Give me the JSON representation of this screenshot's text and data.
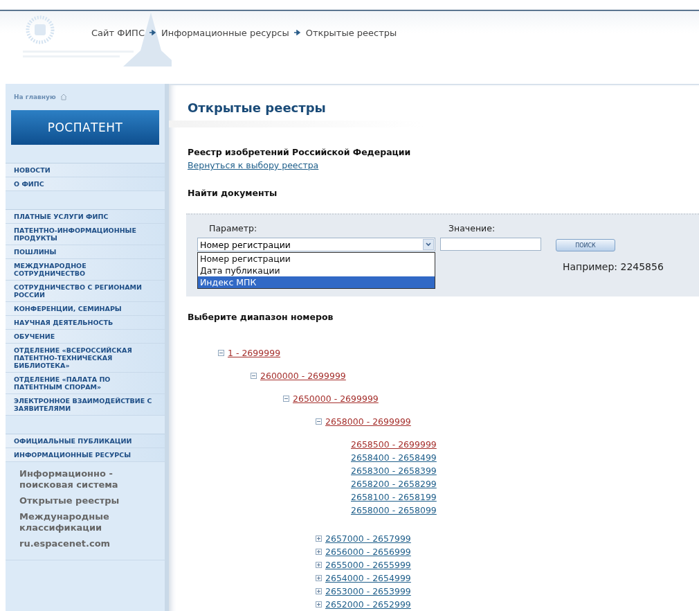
{
  "breadcrumb": [
    "Сайт ФИПС",
    "Информационные ресурсы",
    "Открытые реестры"
  ],
  "sidebar": {
    "home_link": "На главную",
    "banner": "РОСПАТЕНТ",
    "groups": [
      [
        {
          "label": "НОВОСТИ"
        },
        {
          "label": "О ФИПС"
        }
      ],
      [
        {
          "label": "ПЛАТНЫЕ УСЛУГИ ФИПС"
        },
        {
          "label": "ПАТЕНТНО-ИНФОРМАЦИОННЫЕ ПРОДУКТЫ"
        },
        {
          "label": "ПОШЛИНЫ"
        },
        {
          "label": "МЕЖДУНАРОДНОЕ СОТРУДНИЧЕСТВО"
        },
        {
          "label": "СОТРУДНИЧЕСТВО С РЕГИОНАМИ РОССИИ"
        },
        {
          "label": "КОНФЕРЕНЦИИ, СЕМИНАРЫ"
        },
        {
          "label": "НАУЧНАЯ ДЕЯТЕЛЬНОСТЬ"
        },
        {
          "label": "ОБУЧЕНИЕ"
        },
        {
          "label": "ОТДЕЛЕНИЕ «ВСЕРОССИЙСКАЯ ПАТЕНТНО-ТЕХНИЧЕСКАЯ БИБЛИОТЕКА»"
        },
        {
          "label": "ОТДЕЛЕНИЕ «ПАЛАТА ПО ПАТЕНТНЫМ СПОРАМ»"
        },
        {
          "label": "ЭЛЕКТРОННОЕ ВЗАИМОДЕЙСТВИЕ С ЗАЯВИТЕЛЯМИ"
        }
      ],
      [
        {
          "label": "ОФИЦИАЛЬНЫЕ ПУБЛИКАЦИИ"
        },
        {
          "label": "ИНФОРМАЦИОННЫЕ РЕСУРСЫ",
          "children": [
            "Информационно - поисковая система",
            "Открытые реестры",
            "Международные классификации",
            "ru.espacenet.com"
          ]
        }
      ]
    ]
  },
  "page_title": "Открытые реестры",
  "registry_title": "Реестр изобретений Российской Федерации",
  "back_link": "Вернуться к выбору реестра",
  "search": {
    "heading": "Найти документы",
    "parameter_label": "Параметр:",
    "value_label": "Значение:",
    "parameter_value": "Номер регистрации",
    "options": [
      {
        "label": "Номер регистрации",
        "selected": false
      },
      {
        "label": "Дата публикации",
        "selected": false
      },
      {
        "label": "Индекс МПК",
        "selected": true
      }
    ],
    "button": "ПОИСК",
    "example": "Например: 2245856"
  },
  "range_heading": "Выберите диапазон номеров",
  "range_tree": [
    {
      "label": "1 - 2699999",
      "active": true,
      "expanded": true,
      "children": [
        {
          "label": "2600000 - 2699999",
          "active": true,
          "expanded": true,
          "children": [
            {
              "label": "2650000 - 2699999",
              "active": true,
              "expanded": true,
              "children": [
                {
                  "label": "2658000 - 2699999",
                  "active": true,
                  "expanded": true,
                  "children": [
                    {
                      "label": "2658500 - 2699999",
                      "active": true
                    },
                    {
                      "label": "2658400 - 2658499",
                      "active": false
                    },
                    {
                      "label": "2658300 - 2658399",
                      "active": false
                    },
                    {
                      "label": "2658200 - 2658299",
                      "active": false
                    },
                    {
                      "label": "2658100 - 2658199",
                      "active": false
                    },
                    {
                      "label": "2658000 - 2658099",
                      "active": false
                    }
                  ]
                },
                {
                  "label": "2657000 - 2657999",
                  "active": false,
                  "expanded": false
                },
                {
                  "label": "2656000 - 2656999",
                  "active": false,
                  "expanded": false
                },
                {
                  "label": "2655000 - 2655999",
                  "active": false,
                  "expanded": false
                },
                {
                  "label": "2654000 - 2654999",
                  "active": false,
                  "expanded": false
                },
                {
                  "label": "2653000 - 2653999",
                  "active": false,
                  "expanded": false
                },
                {
                  "label": "2652000 - 2652999",
                  "active": false,
                  "expanded": false
                }
              ]
            }
          ]
        }
      ]
    }
  ]
}
